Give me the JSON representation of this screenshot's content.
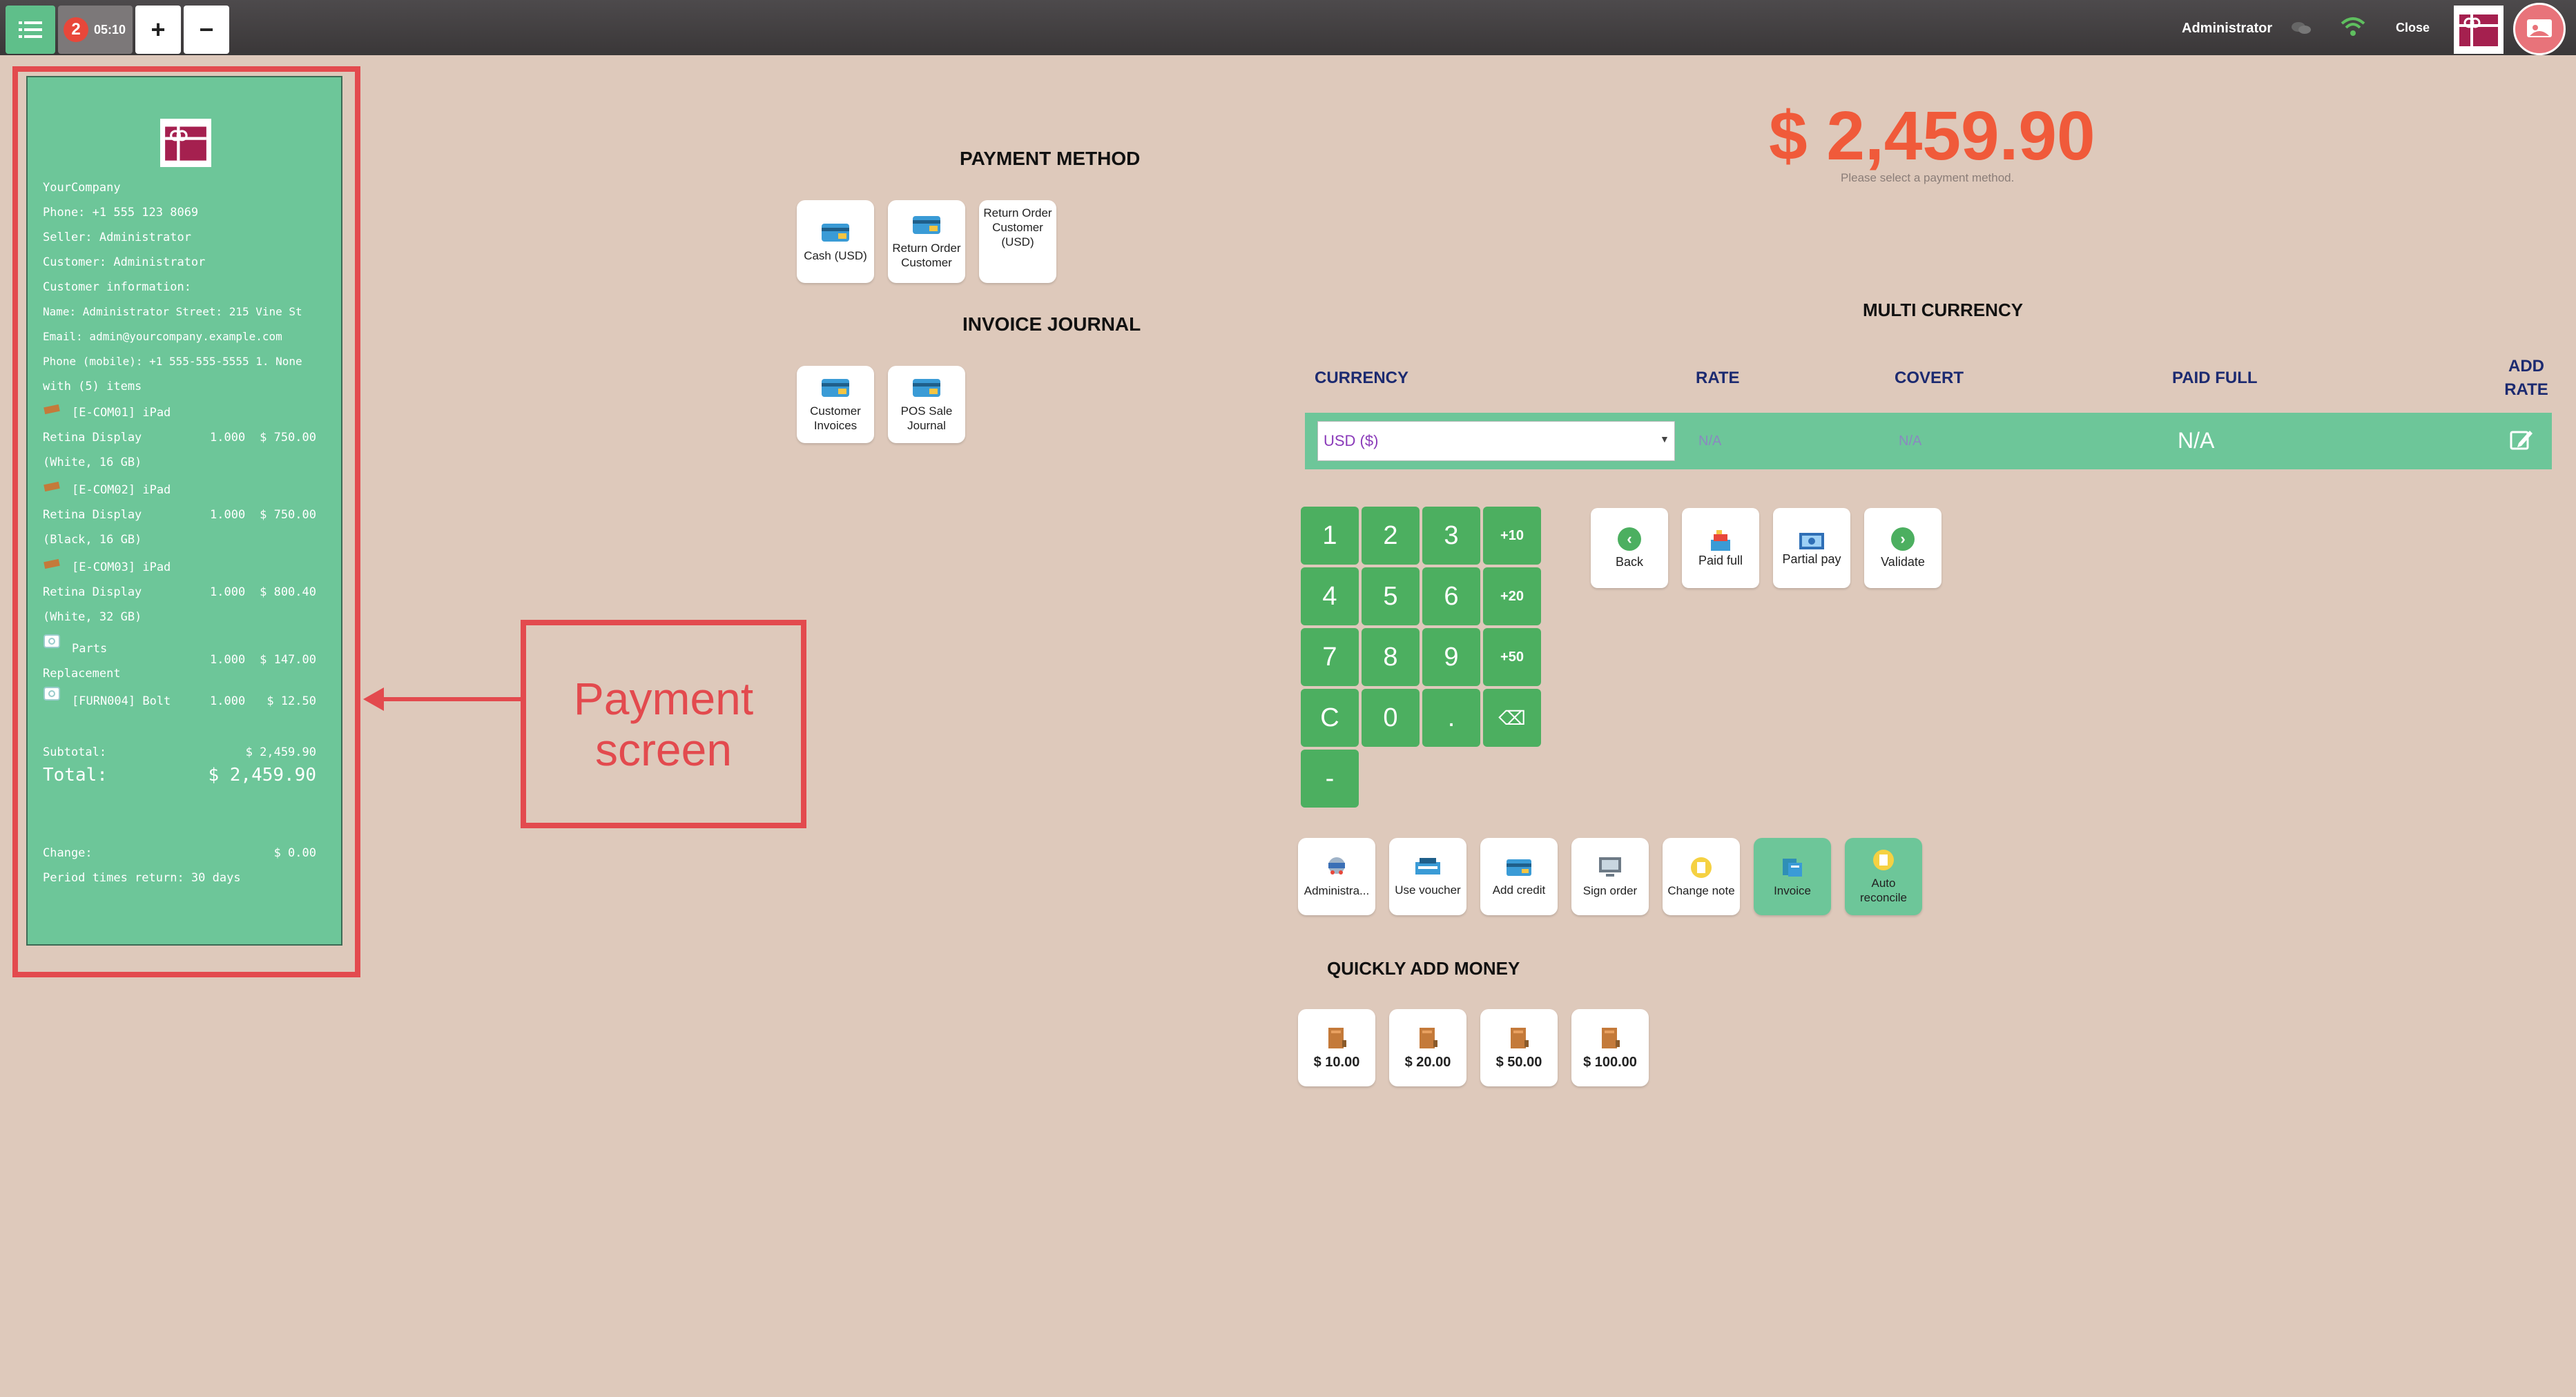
{
  "topbar": {
    "order_count": "2",
    "order_time": "05:10",
    "plus_label": "+",
    "minus_label": "−",
    "user_name": "Administrator",
    "close_label": "Close"
  },
  "receipt": {
    "company": "YourCompany",
    "phone": "Phone: +1 555 123 8069",
    "seller": "Seller: Administrator",
    "customer": "Customer: Administrator",
    "customer_info": "Customer information:",
    "name_street": "Name: Administrator Street: 215 Vine St",
    "email": "Email: admin@yourcompany.example.com",
    "phone_mobile": "Phone (mobile): +1 555-555-5555 1. None",
    "items_count": "with (5) items",
    "lines": [
      {
        "name1": "[E-COM01] iPad",
        "name2": "Retina Display",
        "name3": "(White, 16 GB)",
        "qty": "1.000",
        "price": "$ 750.00"
      },
      {
        "name1": "[E-COM02] iPad",
        "name2": "Retina Display",
        "name3": "(Black, 16 GB)",
        "qty": "1.000",
        "price": "$ 750.00"
      },
      {
        "name1": "[E-COM03] iPad",
        "name2": "Retina Display",
        "name3": "(White, 32 GB)",
        "qty": "1.000",
        "price": "$ 800.40"
      },
      {
        "name1": "Parts",
        "name2": "Replacement",
        "qty": "1.000",
        "price": "$ 147.00"
      },
      {
        "name1": "[FURN004] Bolt",
        "qty": "1.000",
        "price": "$ 12.50"
      }
    ],
    "subtotal_label": "Subtotal:",
    "subtotal_value": "$ 2,459.90",
    "total_label": "Total:",
    "total_value": "$ 2,459.90",
    "change_label": "Change:",
    "change_value": "$ 0.00",
    "return_period": "Period times return: 30 days"
  },
  "callout": {
    "line1": "Payment",
    "line2": "screen"
  },
  "payment_method": {
    "heading": "PAYMENT METHOD",
    "methods": [
      "Cash (USD)",
      "Return Order Customer",
      "Return Order Customer (USD)"
    ]
  },
  "invoice_journal": {
    "heading": "INVOICE JOURNAL",
    "journals": [
      "Customer Invoices",
      "POS Sale Journal"
    ]
  },
  "summary": {
    "total": "$ 2,459.90",
    "hint": "Please select a payment method."
  },
  "multi_currency": {
    "heading": "MULTI CURRENCY",
    "columns": [
      "CURRENCY",
      "RATE",
      "COVERT",
      "PAID FULL",
      "ADD RATE"
    ],
    "selected_currency": "USD ($)",
    "rate": "N/A",
    "covert": "N/A",
    "paid_full": "N/A"
  },
  "numpad": {
    "keys": [
      "1",
      "2",
      "3",
      "+10",
      "4",
      "5",
      "6",
      "+20",
      "7",
      "8",
      "9",
      "+50",
      "C",
      "0",
      ".",
      "⌫",
      "-"
    ]
  },
  "actions": {
    "back": "Back",
    "paid_full": "Paid full",
    "partial_pay": "Partial pay",
    "validate": "Validate"
  },
  "options": {
    "customer": "Administra...",
    "use_voucher": "Use voucher",
    "add_credit": "Add credit",
    "sign_order": "Sign order",
    "change_note": "Change note",
    "invoice": "Invoice",
    "auto_reconcile": "Auto reconcile"
  },
  "quick_money": {
    "heading": "QUICKLY ADD MONEY",
    "amounts": [
      "$ 10.00",
      "$ 20.00",
      "$ 50.00",
      "$ 100.00"
    ]
  },
  "colors": {
    "accent_green": "#6dc699",
    "numpad_green": "#4caf60",
    "total_orange": "#f05a3a",
    "callout_red": "#e34a4e",
    "background": "#dec9bb"
  }
}
